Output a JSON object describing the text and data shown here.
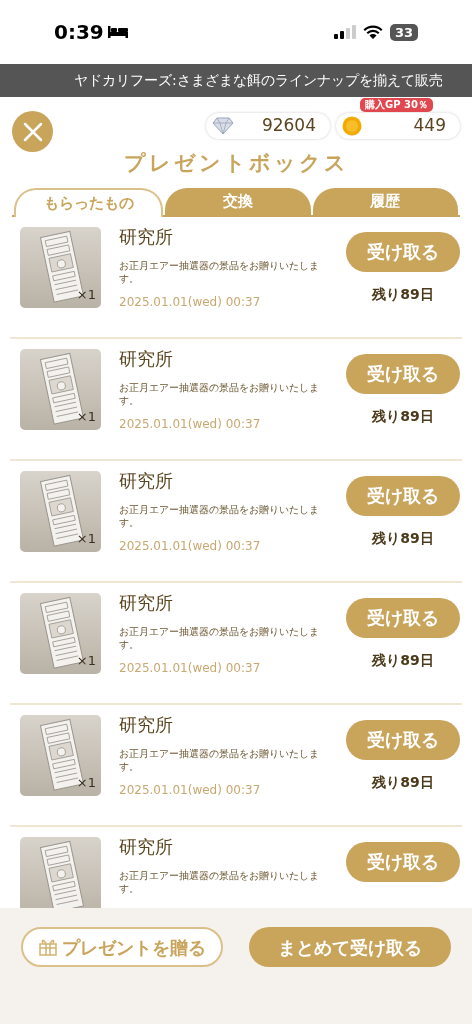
{
  "status_bar": {
    "time": "0:39",
    "battery": "33"
  },
  "marquee": "ヤドカリフーズ:さまざまな餌のラインナップを揃えて販売",
  "currencies": [
    {
      "kind": "gem",
      "value": "92604"
    },
    {
      "kind": "coin",
      "value": "449",
      "badge": "購入GP 30％"
    }
  ],
  "title": "プレゼントボックス",
  "tabs": [
    {
      "label": "もらったもの",
      "selected": true
    },
    {
      "label": "交換",
      "selected": false
    },
    {
      "label": "履歴",
      "selected": false
    }
  ],
  "items": [
    {
      "quantity": "×1",
      "title": "研究所",
      "description": "お正月エアー抽選器の景品をお贈りいたします。",
      "date": "2025.01.01(wed) 00:37",
      "button": "受け取る",
      "remaining": "残り89日"
    },
    {
      "quantity": "×1",
      "title": "研究所",
      "description": "お正月エアー抽選器の景品をお贈りいたします。",
      "date": "2025.01.01(wed) 00:37",
      "button": "受け取る",
      "remaining": "残り89日"
    },
    {
      "quantity": "×1",
      "title": "研究所",
      "description": "お正月エアー抽選器の景品をお贈りいたします。",
      "date": "2025.01.01(wed) 00:37",
      "button": "受け取る",
      "remaining": "残り89日"
    },
    {
      "quantity": "×1",
      "title": "研究所",
      "description": "お正月エアー抽選器の景品をお贈りいたします。",
      "date": "2025.01.01(wed) 00:37",
      "button": "受け取る",
      "remaining": "残り89日"
    },
    {
      "quantity": "×1",
      "title": "研究所",
      "description": "お正月エアー抽選器の景品をお贈りいたします。",
      "date": "2025.01.01(wed) 00:37",
      "button": "受け取る",
      "remaining": "残り89日"
    },
    {
      "title": "研究所",
      "description": "お正月エアー抽選器の景品をお贈りいたします。",
      "button": "受け取る"
    }
  ],
  "footer": {
    "gift_button": "プレゼントを贈る",
    "receive_all_button": "まとめて受け取る"
  }
}
